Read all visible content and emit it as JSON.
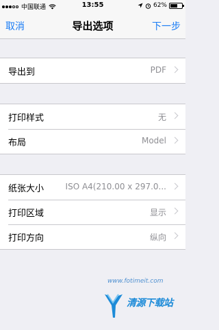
{
  "status_bar": {
    "carrier": "中国联通",
    "time": "13:55",
    "battery_percent_label": "62%",
    "battery_level": 0.62
  },
  "nav": {
    "cancel_label": "取消",
    "title": "导出选项",
    "next_label": "下一步"
  },
  "groups": [
    {
      "rows": [
        {
          "label": "导出到",
          "value": "PDF"
        }
      ]
    },
    {
      "rows": [
        {
          "label": "打印样式",
          "value": "无"
        },
        {
          "label": "布局",
          "value": "Model"
        }
      ]
    },
    {
      "rows": [
        {
          "label": "纸张大小",
          "value": "ISO A4(210.00 x 297.0..."
        },
        {
          "label": "打印区域",
          "value": "显示"
        },
        {
          "label": "打印方向",
          "value": "纵向"
        }
      ]
    }
  ],
  "watermark": {
    "url": "www.fotimeit.com",
    "text": "清源下载站"
  },
  "colors": {
    "accent": "#1a7cf5",
    "background": "#efeff4",
    "secondary_text": "#8e8e93"
  }
}
